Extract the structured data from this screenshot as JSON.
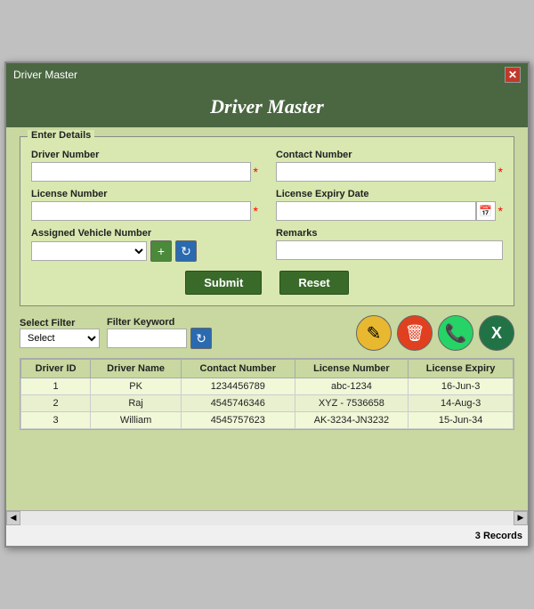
{
  "window": {
    "title": "Driver Master",
    "close_label": "✕"
  },
  "header": {
    "title": "Driver Master"
  },
  "form": {
    "section_label": "Enter Details",
    "driver_number_label": "Driver Number",
    "driver_number_placeholder": "",
    "contact_number_label": "Contact Number",
    "contact_number_placeholder": "",
    "license_number_label": "License Number",
    "license_number_placeholder": "",
    "license_expiry_label": "License Expiry Date",
    "license_expiry_placeholder": "",
    "assigned_vehicle_label": "Assigned Vehicle Number",
    "assigned_vehicle_placeholder": "",
    "remarks_label": "Remarks",
    "remarks_placeholder": "",
    "submit_label": "Submit",
    "reset_label": "Reset"
  },
  "filter": {
    "select_filter_label": "Select Filter",
    "filter_keyword_label": "Filter Keyword",
    "select_placeholder": "Select"
  },
  "table": {
    "columns": [
      "Driver ID",
      "Driver Name",
      "Contact Number",
      "License Number",
      "License Expiry"
    ],
    "rows": [
      {
        "driver_id": "1",
        "driver_name": "PK",
        "contact_number": "1234456789",
        "license_number": "abc-1234",
        "license_expiry": "16-Jun-3"
      },
      {
        "driver_id": "2",
        "driver_name": "Raj",
        "contact_number": "4545746346",
        "license_number": "XYZ - 7536658",
        "license_expiry": "14-Aug-3"
      },
      {
        "driver_id": "3",
        "driver_name": "William",
        "contact_number": "4545757623",
        "license_number": "AK-3234-JN3232",
        "license_expiry": "15-Jun-34"
      }
    ]
  },
  "footer": {
    "records_count": "3 Records"
  },
  "icons": {
    "add": "+",
    "refresh": "↻",
    "edit": "✎",
    "delete": "🗑",
    "whatsapp": "📱",
    "excel": "X",
    "calendar": "📅",
    "scroll_left": "◀",
    "scroll_right": "▶"
  }
}
